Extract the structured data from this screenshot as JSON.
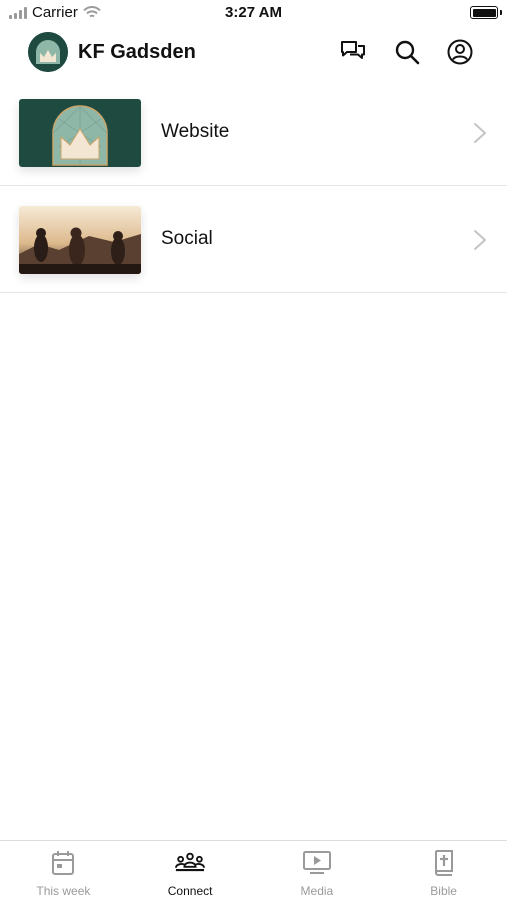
{
  "status_bar": {
    "carrier": "Carrier",
    "time": "3:27 AM"
  },
  "header": {
    "title": "KF Gadsden",
    "icons": [
      "chat-icon",
      "search-icon",
      "profile-icon"
    ]
  },
  "list": [
    {
      "label": "Website",
      "thumbnail": "church-logo"
    },
    {
      "label": "Social",
      "thumbnail": "people-sunset-photo"
    }
  ],
  "tabs": [
    {
      "label": "This week",
      "icon": "calendar-icon",
      "active": false
    },
    {
      "label": "Connect",
      "icon": "people-group-icon",
      "active": true
    },
    {
      "label": "Media",
      "icon": "play-screen-icon",
      "active": false
    },
    {
      "label": "Bible",
      "icon": "bible-cross-icon",
      "active": false
    }
  ],
  "colors": {
    "brand_green": "#1f4a40",
    "active": "#111111",
    "inactive": "#9a9a9a"
  }
}
